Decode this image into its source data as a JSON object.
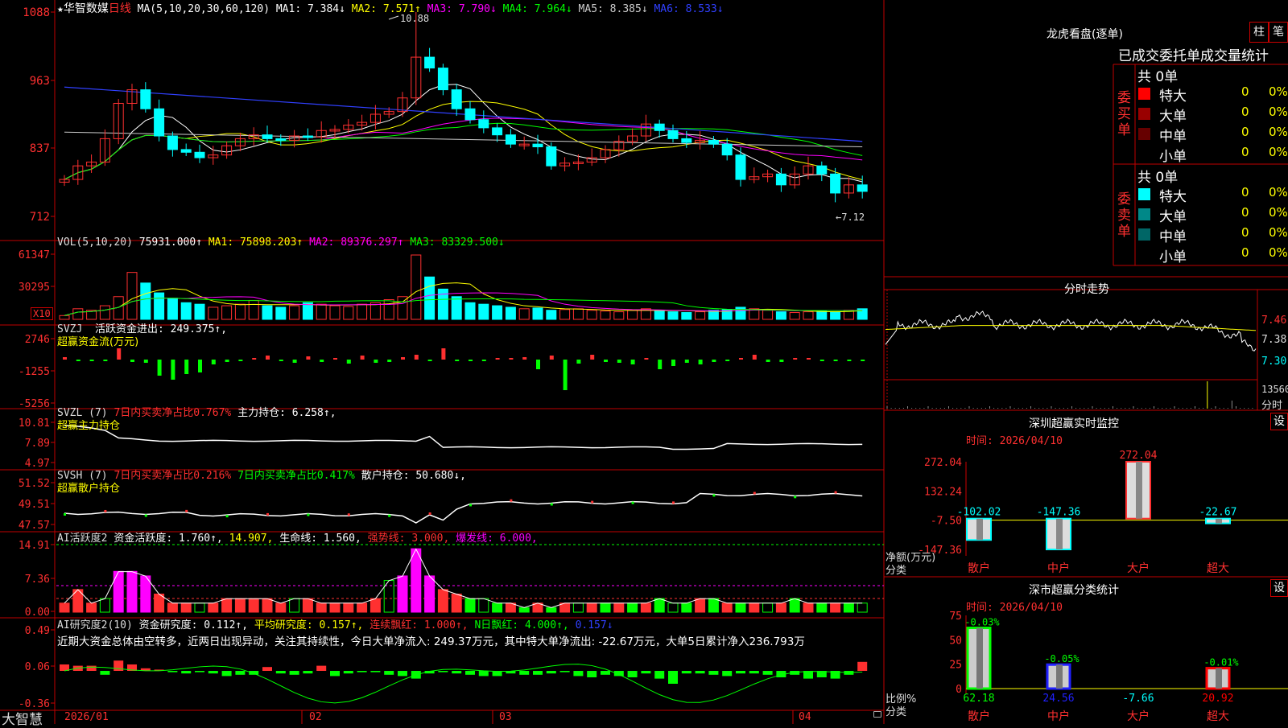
{
  "app": {
    "name": "大智慧",
    "lock_icon": "lock-icon"
  },
  "main_chart": {
    "star": "★",
    "stock_name": "华智数媒",
    "period": "日线",
    "ma_label": "MA(5,10,20,30,60,120)",
    "ma_items": [
      {
        "text": "MA1: 7.384↓",
        "color": "#ffffff"
      },
      {
        "text": "MA2: 7.571↑",
        "color": "#ffff00"
      },
      {
        "text": "MA3: 7.790↓",
        "color": "#ff00ff"
      },
      {
        "text": "MA4: 7.964↓",
        "color": "#00ff00"
      },
      {
        "text": "MA5: 8.385↓",
        "color": "#cccccc"
      },
      {
        "text": "MA6: 8.533↓",
        "color": "#3040ff"
      }
    ],
    "y_ticks": [
      "10.88",
      "9.63",
      "8.37",
      "7.12"
    ],
    "high_label": "10.88",
    "low_label": "←7.12"
  },
  "vol_panel": {
    "label": "VOL(5,10,20)",
    "items": [
      {
        "text": "75931.000↑",
        "color": "#ffffff"
      },
      {
        "text": "MA1: 75898.203↑",
        "color": "#ffff00"
      },
      {
        "text": "MA2: 89376.297↑",
        "color": "#ff00ff"
      },
      {
        "text": "MA3: 83329.500↓",
        "color": "#00ff00"
      }
    ],
    "y_ticks": [
      "61347",
      "30295"
    ],
    "unit": "X10"
  },
  "svzj_panel": {
    "label": "SVZJ",
    "items": [
      {
        "text": "活跃资金进出: 249.375↑,",
        "color": "#ffffff"
      }
    ],
    "sub": "超赢资金流(万元)",
    "y_ticks": [
      "2746",
      "-1255",
      "-5256"
    ]
  },
  "svzl_panel": {
    "label": "SVZL (7)",
    "items": [
      {
        "text": "7日内买卖净占比0.767%",
        "color": "#ff3030"
      },
      {
        "text": "主力持仓: 6.258↑,",
        "color": "#ffffff"
      }
    ],
    "sub": "超赢主力持仓",
    "y_ticks": [
      "10.81",
      "7.89",
      "4.97"
    ]
  },
  "svsh_panel": {
    "label": "SVSH (7)",
    "items": [
      {
        "text": "7日内买卖净占比0.216%",
        "color": "#ff3030"
      },
      {
        "text": "7日内买卖净占比0.417%",
        "color": "#00ff00"
      },
      {
        "text": "散户持仓: 50.680↓,",
        "color": "#ffffff"
      }
    ],
    "sub": "超赢散户持仓",
    "y_ticks": [
      "51.52",
      "49.51",
      "47.57"
    ]
  },
  "ai_active_panel": {
    "label": "AI活跃度2",
    "items": [
      {
        "text": "资金活跃度: 1.760↑,",
        "color": "#ffffff"
      },
      {
        "text": "14.907,",
        "color": "#ffff00"
      },
      {
        "text": "生命线: 1.560,",
        "color": "#ffffff"
      },
      {
        "text": "强势线: 3.000,",
        "color": "#ff3030"
      },
      {
        "text": "爆发线: 6.000,",
        "color": "#ff00ff"
      }
    ],
    "y_ticks": [
      "14.91",
      "7.36",
      "0.00"
    ]
  },
  "ai_research_panel": {
    "label": "AI研究度2(10)",
    "items": [
      {
        "text": "资金研究度: 0.112↑,",
        "color": "#ffffff"
      },
      {
        "text": "平均研究度: 0.157↑,",
        "color": "#ffff00"
      },
      {
        "text": "连续飘红: 1.000↑,",
        "color": "#ff3030"
      },
      {
        "text": "N日飘红: 4.000↑,",
        "color": "#00ff00"
      },
      {
        "text": "0.157↓",
        "color": "#3040ff"
      }
    ],
    "comment": "近期大资金总体由空转多，近两日出现异动，关注其持续性，今日大单净流入: 249.37万元，其中特大单净流出: -22.67万元，大单5日累计净入236.793万",
    "y_ticks": [
      "0.49",
      "0.06",
      "-0.36"
    ]
  },
  "x_axis": {
    "labels": [
      "2026/01",
      "02",
      "03",
      "04"
    ]
  },
  "dragon_tiger": {
    "title": "龙虎看盘(逐单)",
    "btn_column": "柱",
    "btn_stroke": "笔",
    "header": "已成交委托单成交量统计",
    "buy_label": "委买单",
    "sell_label": "委卖单",
    "buy_total": "共 0单",
    "sell_total": "共 0单",
    "buy_rows": [
      {
        "label": "特大",
        "count": "0",
        "pct": "0%",
        "color": "#ff0000"
      },
      {
        "label": "大单",
        "count": "0",
        "pct": "0%",
        "color": "#990000"
      },
      {
        "label": "中单",
        "count": "0",
        "pct": "0%",
        "color": "#660000"
      },
      {
        "label": "小单",
        "count": "0",
        "pct": "0%",
        "color": "#000000"
      }
    ],
    "sell_rows": [
      {
        "label": "特大",
        "count": "0",
        "pct": "0%",
        "color": "#00ffff"
      },
      {
        "label": "大单",
        "count": "0",
        "pct": "0%",
        "color": "#008888"
      },
      {
        "label": "中单",
        "count": "0",
        "pct": "0%",
        "color": "#006666"
      },
      {
        "label": "小单",
        "count": "0",
        "pct": "0%",
        "color": "#000000"
      }
    ]
  },
  "intraday": {
    "title": "分时走势",
    "y_ticks": [
      "7.46",
      "7.38",
      "7.30"
    ],
    "vol_tick": "13560",
    "vol_unit": "分时"
  },
  "sz_monitor": {
    "title": "深圳超赢实时监控",
    "settings": "设",
    "time_label": "时间: 2026/04/10",
    "y_ticks": [
      "272.04",
      "132.24",
      "-7.50",
      "-147.36"
    ],
    "y_caption": "净额(万元)",
    "x_caption": "分类",
    "chart_data": {
      "type": "bar",
      "categories": [
        "散户",
        "中户",
        "大户",
        "超大"
      ],
      "values": [
        -102.02,
        -147.36,
        272.04,
        -22.67
      ],
      "labels": [
        "-102.02",
        "-147.36",
        "272.04",
        "-22.67"
      ],
      "ylim": [
        -147.36,
        272.04
      ],
      "label_colors": [
        "#00ffff",
        "#00ffff",
        "#ff3030",
        "#00ffff"
      ]
    }
  },
  "sz_class": {
    "title": "深市超赢分类统计",
    "settings": "设",
    "time_label": "时间: 2026/04/10",
    "y_ticks": [
      "75",
      "50",
      "25",
      "0"
    ],
    "y_caption": "比例%",
    "x_caption": "分类",
    "chart_data": {
      "type": "bar",
      "categories": [
        "散户",
        "中户",
        "大户",
        "超大"
      ],
      "values": [
        62.18,
        24.56,
        -7.66,
        20.92
      ],
      "bottom_labels": [
        "62.18",
        "24.56",
        "-7.66",
        "20.92"
      ],
      "changes": [
        "-0.03%",
        "-0.05%",
        "",
        "-0.01%"
      ],
      "ylim": [
        0,
        75
      ],
      "colors": [
        "#00ff00",
        "#2020ff",
        "#00ffff",
        "#ff0000"
      ]
    }
  }
}
